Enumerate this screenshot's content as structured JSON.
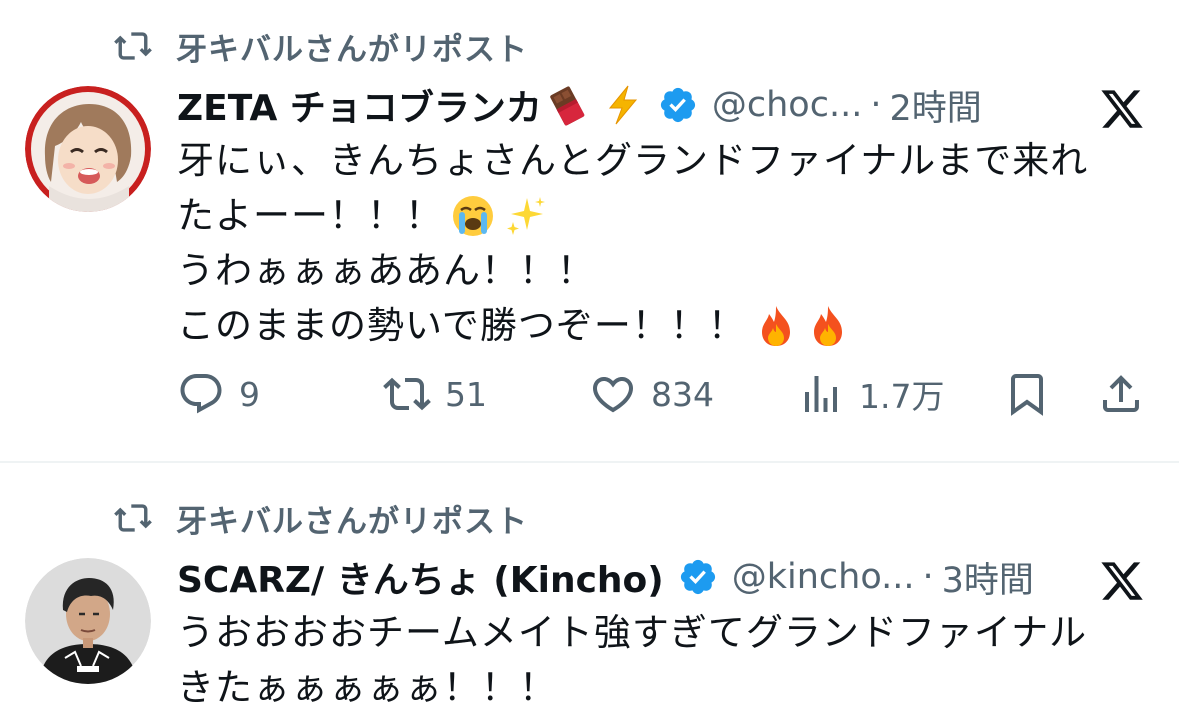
{
  "posts": [
    {
      "repost_label": "牙キバルさんがリポスト",
      "display_name": "ZETA チョコブランカ",
      "name_emojis": [
        "chocolate-bar-emoji",
        "high-voltage-emoji"
      ],
      "verified": true,
      "handle": "@choc...",
      "separator": "·",
      "time": "2時間",
      "lines": [
        {
          "text": "牙にぃ、きんちょさんとグランドファイナルまで来れ",
          "emojis": []
        },
        {
          "text": "たよーー！！！",
          "emojis": [
            "loudly-crying-face-emoji",
            "sparkles-emoji"
          ]
        },
        {
          "text": "うわぁぁぁああん！！！",
          "emojis": []
        },
        {
          "text": "このままの勢いで勝つぞー！！！",
          "emojis": [
            "fire-emoji",
            "fire-emoji"
          ]
        }
      ],
      "actions": {
        "replies": "9",
        "reposts": "51",
        "likes": "834",
        "views": "1.7万"
      }
    },
    {
      "repost_label": "牙キバルさんがリポスト",
      "display_name": "SCARZ/ きんちょ (Kincho)",
      "verified": true,
      "handle": "@kincho...",
      "separator": "·",
      "time": "3時間",
      "lines": [
        {
          "text": "うおおおおチームメイト強すぎてグランドファイナル"
        },
        {
          "text": "きたぁぁぁぁぁ！！！"
        }
      ]
    }
  ],
  "colors": {
    "text_primary": "#0f1419",
    "text_secondary": "#536471",
    "verified_blue": "#1d9bf0",
    "divider": "#eff3f4",
    "avatar_ring_red": "#c8201f"
  }
}
